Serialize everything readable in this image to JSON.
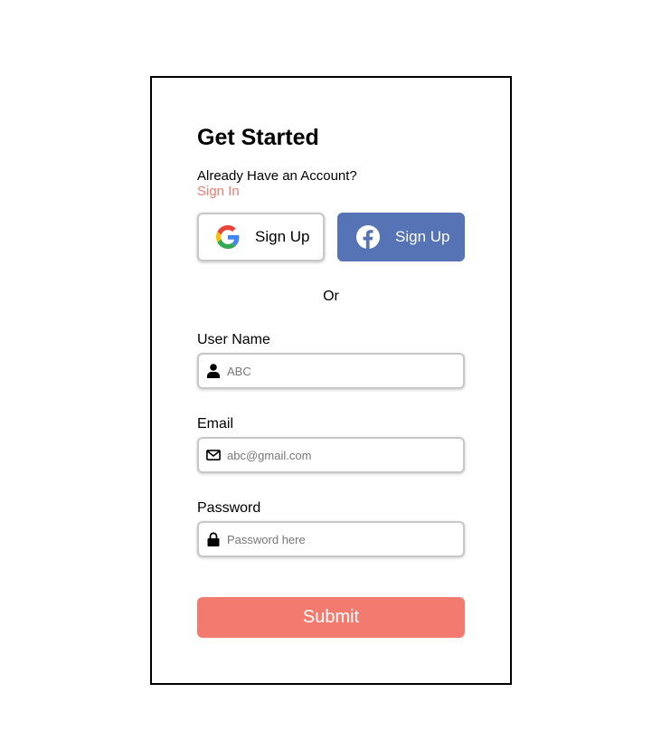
{
  "form": {
    "title": "Get Started",
    "already_text": "Already Have an Account?",
    "signin_link": "Sign In",
    "google_button_label": "Sign Up",
    "facebook_button_label": "Sign Up",
    "separator": "Or",
    "username": {
      "label": "User Name",
      "placeholder": "ABC",
      "icon": "user-icon"
    },
    "email": {
      "label": "Email",
      "placeholder": "abc@gmail.com",
      "icon": "envelope-icon"
    },
    "password": {
      "label": "Password",
      "placeholder": "Password here",
      "icon": "lock-icon"
    },
    "submit_label": "Submit"
  },
  "colors": {
    "accent": "#f27a6e",
    "facebook": "#5673b5",
    "input_border": "#c7c7c7"
  }
}
